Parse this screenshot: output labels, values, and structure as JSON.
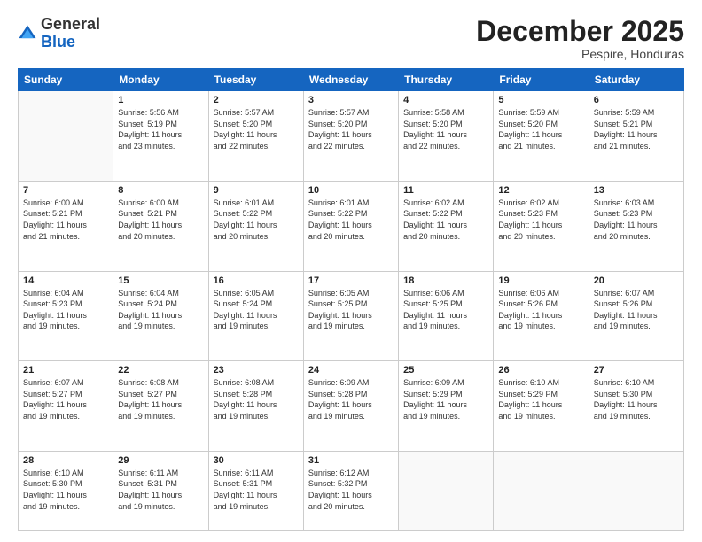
{
  "header": {
    "logo_general": "General",
    "logo_blue": "Blue",
    "month_title": "December 2025",
    "subtitle": "Pespire, Honduras"
  },
  "days_of_week": [
    "Sunday",
    "Monday",
    "Tuesday",
    "Wednesday",
    "Thursday",
    "Friday",
    "Saturday"
  ],
  "weeks": [
    [
      {
        "day": "",
        "info": ""
      },
      {
        "day": "1",
        "info": "Sunrise: 5:56 AM\nSunset: 5:19 PM\nDaylight: 11 hours\nand 23 minutes."
      },
      {
        "day": "2",
        "info": "Sunrise: 5:57 AM\nSunset: 5:20 PM\nDaylight: 11 hours\nand 22 minutes."
      },
      {
        "day": "3",
        "info": "Sunrise: 5:57 AM\nSunset: 5:20 PM\nDaylight: 11 hours\nand 22 minutes."
      },
      {
        "day": "4",
        "info": "Sunrise: 5:58 AM\nSunset: 5:20 PM\nDaylight: 11 hours\nand 22 minutes."
      },
      {
        "day": "5",
        "info": "Sunrise: 5:59 AM\nSunset: 5:20 PM\nDaylight: 11 hours\nand 21 minutes."
      },
      {
        "day": "6",
        "info": "Sunrise: 5:59 AM\nSunset: 5:21 PM\nDaylight: 11 hours\nand 21 minutes."
      }
    ],
    [
      {
        "day": "7",
        "info": "Sunrise: 6:00 AM\nSunset: 5:21 PM\nDaylight: 11 hours\nand 21 minutes."
      },
      {
        "day": "8",
        "info": "Sunrise: 6:00 AM\nSunset: 5:21 PM\nDaylight: 11 hours\nand 20 minutes."
      },
      {
        "day": "9",
        "info": "Sunrise: 6:01 AM\nSunset: 5:22 PM\nDaylight: 11 hours\nand 20 minutes."
      },
      {
        "day": "10",
        "info": "Sunrise: 6:01 AM\nSunset: 5:22 PM\nDaylight: 11 hours\nand 20 minutes."
      },
      {
        "day": "11",
        "info": "Sunrise: 6:02 AM\nSunset: 5:22 PM\nDaylight: 11 hours\nand 20 minutes."
      },
      {
        "day": "12",
        "info": "Sunrise: 6:02 AM\nSunset: 5:23 PM\nDaylight: 11 hours\nand 20 minutes."
      },
      {
        "day": "13",
        "info": "Sunrise: 6:03 AM\nSunset: 5:23 PM\nDaylight: 11 hours\nand 20 minutes."
      }
    ],
    [
      {
        "day": "14",
        "info": "Sunrise: 6:04 AM\nSunset: 5:23 PM\nDaylight: 11 hours\nand 19 minutes."
      },
      {
        "day": "15",
        "info": "Sunrise: 6:04 AM\nSunset: 5:24 PM\nDaylight: 11 hours\nand 19 minutes."
      },
      {
        "day": "16",
        "info": "Sunrise: 6:05 AM\nSunset: 5:24 PM\nDaylight: 11 hours\nand 19 minutes."
      },
      {
        "day": "17",
        "info": "Sunrise: 6:05 AM\nSunset: 5:25 PM\nDaylight: 11 hours\nand 19 minutes."
      },
      {
        "day": "18",
        "info": "Sunrise: 6:06 AM\nSunset: 5:25 PM\nDaylight: 11 hours\nand 19 minutes."
      },
      {
        "day": "19",
        "info": "Sunrise: 6:06 AM\nSunset: 5:26 PM\nDaylight: 11 hours\nand 19 minutes."
      },
      {
        "day": "20",
        "info": "Sunrise: 6:07 AM\nSunset: 5:26 PM\nDaylight: 11 hours\nand 19 minutes."
      }
    ],
    [
      {
        "day": "21",
        "info": "Sunrise: 6:07 AM\nSunset: 5:27 PM\nDaylight: 11 hours\nand 19 minutes."
      },
      {
        "day": "22",
        "info": "Sunrise: 6:08 AM\nSunset: 5:27 PM\nDaylight: 11 hours\nand 19 minutes."
      },
      {
        "day": "23",
        "info": "Sunrise: 6:08 AM\nSunset: 5:28 PM\nDaylight: 11 hours\nand 19 minutes."
      },
      {
        "day": "24",
        "info": "Sunrise: 6:09 AM\nSunset: 5:28 PM\nDaylight: 11 hours\nand 19 minutes."
      },
      {
        "day": "25",
        "info": "Sunrise: 6:09 AM\nSunset: 5:29 PM\nDaylight: 11 hours\nand 19 minutes."
      },
      {
        "day": "26",
        "info": "Sunrise: 6:10 AM\nSunset: 5:29 PM\nDaylight: 11 hours\nand 19 minutes."
      },
      {
        "day": "27",
        "info": "Sunrise: 6:10 AM\nSunset: 5:30 PM\nDaylight: 11 hours\nand 19 minutes."
      }
    ],
    [
      {
        "day": "28",
        "info": "Sunrise: 6:10 AM\nSunset: 5:30 PM\nDaylight: 11 hours\nand 19 minutes."
      },
      {
        "day": "29",
        "info": "Sunrise: 6:11 AM\nSunset: 5:31 PM\nDaylight: 11 hours\nand 19 minutes."
      },
      {
        "day": "30",
        "info": "Sunrise: 6:11 AM\nSunset: 5:31 PM\nDaylight: 11 hours\nand 19 minutes."
      },
      {
        "day": "31",
        "info": "Sunrise: 6:12 AM\nSunset: 5:32 PM\nDaylight: 11 hours\nand 20 minutes."
      },
      {
        "day": "",
        "info": ""
      },
      {
        "day": "",
        "info": ""
      },
      {
        "day": "",
        "info": ""
      }
    ]
  ]
}
